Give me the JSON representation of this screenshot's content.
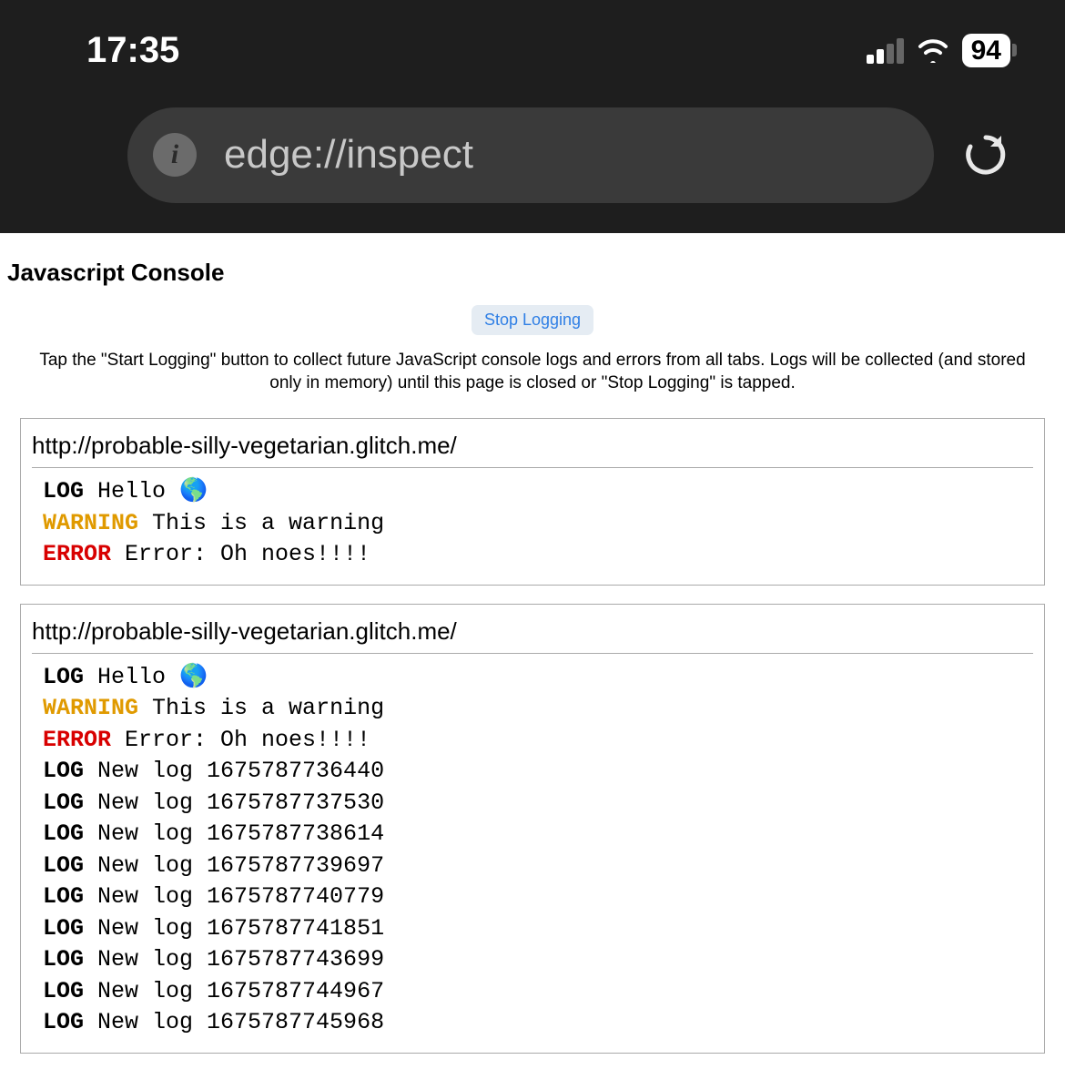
{
  "status": {
    "time": "17:35",
    "battery": "94"
  },
  "address": {
    "url": "edge://inspect"
  },
  "page": {
    "title": "Javascript Console",
    "stop_logging": "Stop Logging",
    "instructions": "Tap the \"Start Logging\" button to collect future JavaScript console logs and errors from all tabs. Logs will be collected (and stored only in memory) until this page is closed or \"Stop Logging\" is tapped."
  },
  "panels": [
    {
      "source": "http://probable-silly-vegetarian.glitch.me/",
      "entries": [
        {
          "level": "LOG",
          "message": "Hello 🌎"
        },
        {
          "level": "WARNING",
          "message": "This is a warning"
        },
        {
          "level": "ERROR",
          "message": "Error: Oh noes!!!!"
        }
      ]
    },
    {
      "source": "http://probable-silly-vegetarian.glitch.me/",
      "entries": [
        {
          "level": "LOG",
          "message": "Hello 🌎"
        },
        {
          "level": "WARNING",
          "message": "This is a warning"
        },
        {
          "level": "ERROR",
          "message": "Error: Oh noes!!!!"
        },
        {
          "level": "LOG",
          "message": "New log 1675787736440"
        },
        {
          "level": "LOG",
          "message": "New log 1675787737530"
        },
        {
          "level": "LOG",
          "message": "New log 1675787738614"
        },
        {
          "level": "LOG",
          "message": "New log 1675787739697"
        },
        {
          "level": "LOG",
          "message": "New log 1675787740779"
        },
        {
          "level": "LOG",
          "message": "New log 1675787741851"
        },
        {
          "level": "LOG",
          "message": "New log 1675787743699"
        },
        {
          "level": "LOG",
          "message": "New log 1675787744967"
        },
        {
          "level": "LOG",
          "message": "New log 1675787745968"
        }
      ]
    }
  ]
}
